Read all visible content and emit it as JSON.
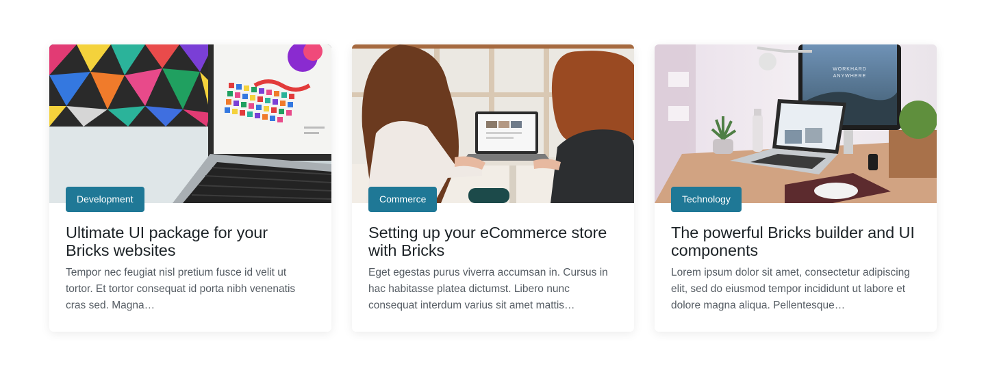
{
  "posts": [
    {
      "category": "Development",
      "title": "Ultimate UI package for your Bricks websites",
      "excerpt": "Tempor nec feugiat nisl pretium fusce id velit ut tortor. Et tortor consequat id porta nibh venenatis cras sed. Magna…",
      "image": "laptop-colorful-design-photo"
    },
    {
      "category": "Commerce",
      "title": "Setting up your eCommerce store with Bricks",
      "excerpt": "Eget egestas purus viverra accumsan in. Cursus in hac habitasse platea dictumst. Libero nunc consequat interdum varius sit amet mattis…",
      "image": "two-women-laptop-photo"
    },
    {
      "category": "Technology",
      "title": "The powerful Bricks builder and UI components",
      "excerpt": "Lorem ipsum dolor sit amet, consectetur adipiscing elit, sed do eiusmod tempor incididunt ut labore et dolore magna aliqua. Pellentesque…",
      "image": "desk-workspace-photo",
      "image_text": [
        "WORKHARD",
        "ANYWHERE"
      ]
    }
  ],
  "colors": {
    "tag_background": "#1f7896",
    "title": "#1d2327",
    "excerpt": "#555c63"
  }
}
